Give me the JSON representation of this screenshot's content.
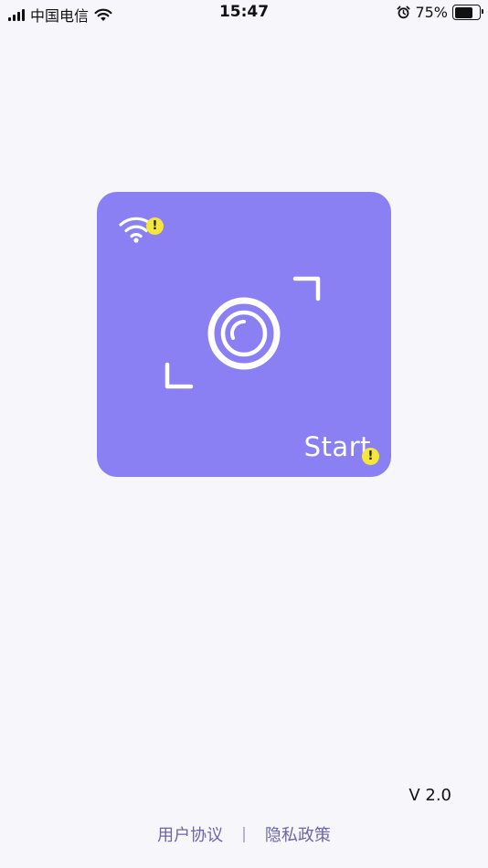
{
  "status_bar": {
    "carrier": "中国电信",
    "time": "15:47",
    "battery_percent": "75%",
    "battery_level": 0.75,
    "icons": [
      "signal-icon",
      "wifi-icon",
      "alarm-icon",
      "battery-icon"
    ]
  },
  "card": {
    "accent_color": "#8a80f3",
    "start_label": "Start",
    "warning_glyph": "!",
    "icons": [
      "wifi-icon",
      "warning-icon",
      "camera-icon",
      "scan-frame-icon"
    ]
  },
  "version": "V 2.0",
  "footer": {
    "user_agreement": "用户协议",
    "separator": "|",
    "privacy_policy": "隐私政策"
  }
}
